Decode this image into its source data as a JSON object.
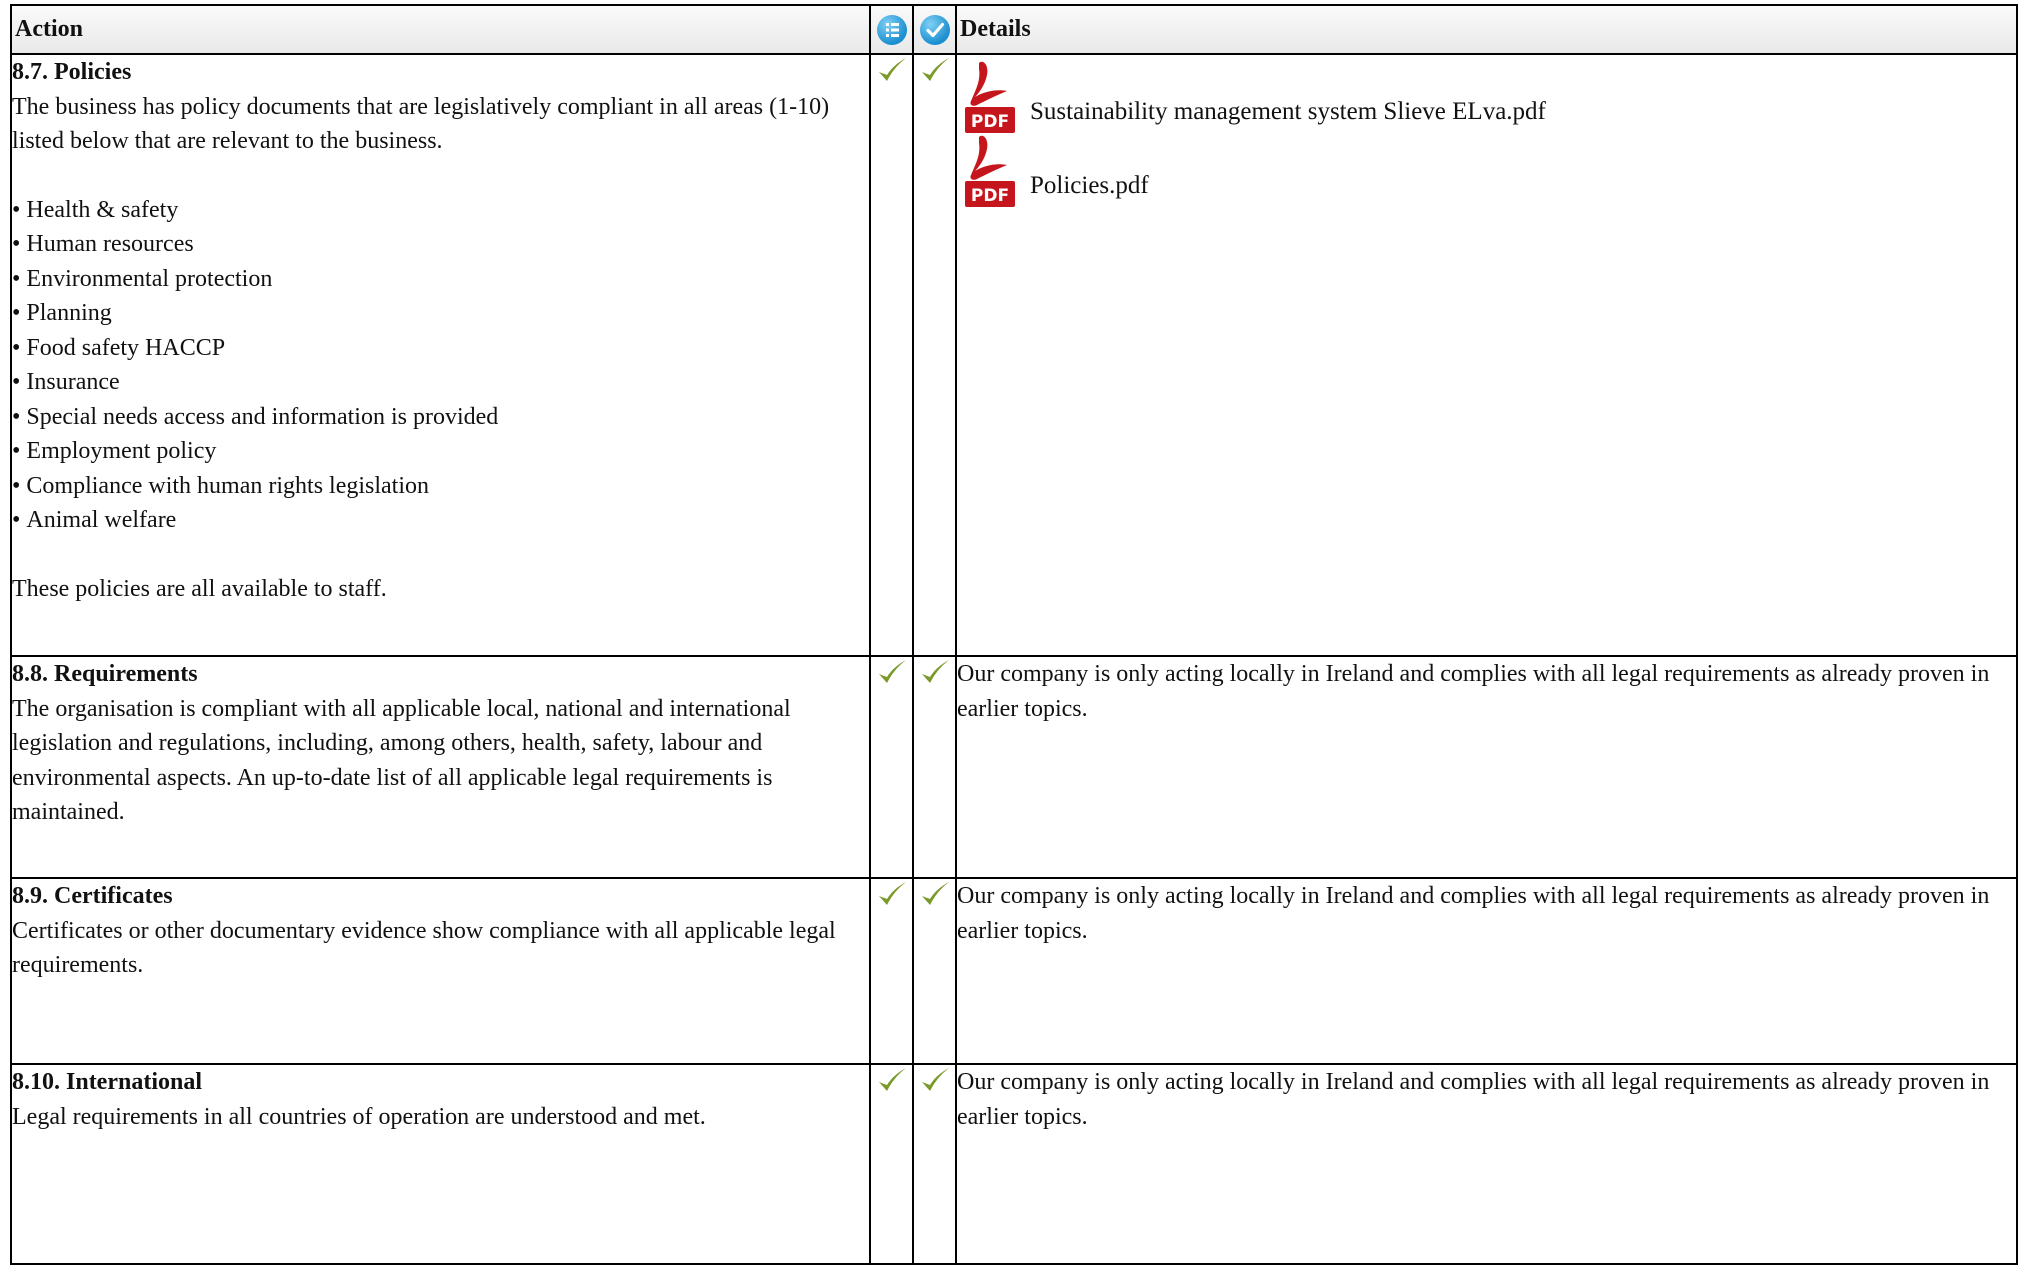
{
  "table": {
    "header": {
      "action": "Action",
      "details": "Details"
    },
    "header_icons": [
      "list-info-icon",
      "checkmark-circle-icon"
    ],
    "rows": [
      {
        "title": "8.7. Policies",
        "description": "The business has policy documents that are legislatively compliant in all areas (1-10) listed below that are relevant to the business.",
        "bullets": [
          "Health & safety",
          "Human resources",
          "Environmental protection",
          "Planning",
          "Food safety HACCP",
          "Insurance",
          "Special needs access and information is provided",
          "Employment policy",
          "Compliance with human rights legislation",
          "Animal welfare"
        ],
        "footer": "These policies are all available to staff.",
        "attachments": [
          {
            "icon": "pdf-file-icon",
            "name": "Sustainability management system Slieve ELva.pdf"
          },
          {
            "icon": "pdf-file-icon",
            "name": "Policies.pdf"
          }
        ]
      },
      {
        "title": "8.8. Requirements",
        "description": "The organisation is compliant with all applicable local, national and international legislation and regulations, including, among others, health, safety, labour and environmental aspects. An up-to-date list of all applicable legal requirements is maintained.",
        "details": "Our company is only acting locally in Ireland and complies with all legal requirements as already proven in earlier topics."
      },
      {
        "title": "8.9. Certificates",
        "description": "Certificates or other documentary evidence show compliance with all applicable legal requirements.",
        "details": "Our company is only acting locally in Ireland and complies with all legal requirements as already proven in earlier topics."
      },
      {
        "title": "8.10. International",
        "description": "Legal requirements in all countries of operation are understood and met.",
        "details": "Our company is only acting locally in Ireland and complies with all legal requirements as already proven in earlier topics."
      }
    ],
    "check_icon": "checkmark-icon",
    "colors": {
      "check": "#7a9a2a",
      "header_icon": "#1b8fcf",
      "pdf": "#c4161c"
    }
  }
}
